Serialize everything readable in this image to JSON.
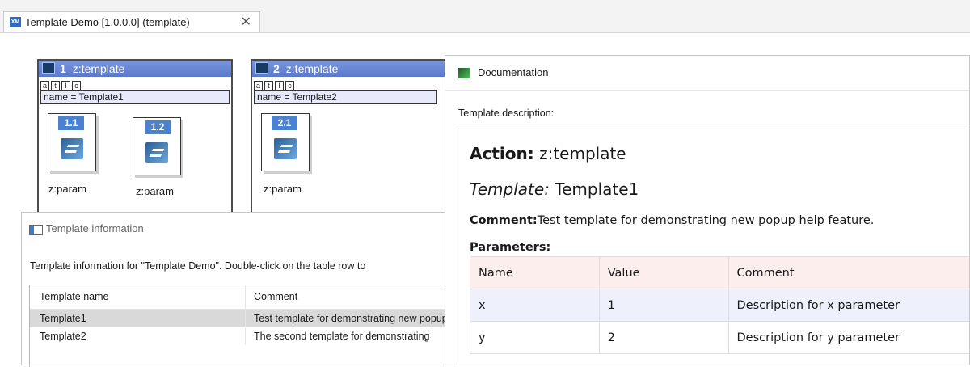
{
  "tab": {
    "title": "Template Demo [1.0.0.0] (template)",
    "close_glyph": "✕",
    "icon": "xml-editor-icon"
  },
  "canvas": {
    "templates": [
      {
        "number": "1",
        "title": "z:template",
        "tabs": [
          "a",
          "t",
          "l",
          "c"
        ],
        "name": "name = Template1",
        "params": [
          {
            "number": "1.1",
            "label": "z:param"
          },
          {
            "number": "1.2",
            "label": "z:param"
          }
        ]
      },
      {
        "number": "2",
        "title": "z:template",
        "tabs": [
          "a",
          "t",
          "l",
          "c"
        ],
        "name": "name = Template2",
        "params": [
          {
            "number": "2.1",
            "label": "z:param"
          }
        ]
      }
    ]
  },
  "template_info": {
    "title": "Template information",
    "description": "Template information for \"Template Demo\". Double-click on the table row to",
    "columns": [
      "Template name",
      "Comment"
    ],
    "rows": [
      {
        "name": "Template1",
        "comment": "Test template for demonstrating new popup help feature.",
        "selected": true
      },
      {
        "name": "Template2",
        "comment": "The second template for demonstrating",
        "selected": false
      }
    ]
  },
  "documentation": {
    "title": "Documentation",
    "subtitle": "Template description:",
    "action_label": "Action:",
    "action_value": " z:template",
    "template_label": "Template:",
    "template_value": " Template1",
    "comment_label": "Comment:",
    "comment_value": "Test template for demonstrating new popup help feature.",
    "parameters_label": "Parameters:",
    "columns": [
      "Name",
      "Value",
      "Comment"
    ],
    "rows": [
      {
        "name": "x",
        "value": "1",
        "comment": "Description for x parameter"
      },
      {
        "name": "y",
        "value": "2",
        "comment": "Description for y parameter"
      }
    ]
  },
  "colors": {
    "template_header": "#5b78cb",
    "param_badge": "#4a82d0",
    "selected_row": "#d9d9d9",
    "param_header_row": "#fdeeee",
    "param_row_1": "#eef0fb"
  }
}
